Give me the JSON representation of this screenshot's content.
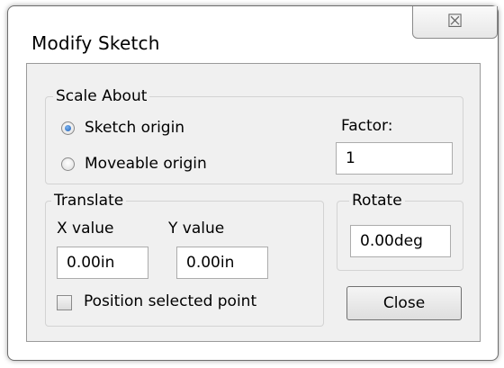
{
  "dialog": {
    "title": "Modify Sketch",
    "close_icon_glyph": "☒"
  },
  "scale_about": {
    "legend": "Scale About",
    "options": [
      {
        "label": "Sketch origin",
        "checked": true
      },
      {
        "label": "Moveable origin",
        "checked": false
      }
    ],
    "factor_label": "Factor:",
    "factor_value": "1"
  },
  "translate": {
    "legend": "Translate",
    "x_label": "X value",
    "y_label": "Y value",
    "x_value": "0.00in",
    "y_value": "0.00in",
    "position_selected_point_label": "Position selected point",
    "position_selected_point_checked": false
  },
  "rotate": {
    "legend": "Rotate",
    "value": "0.00deg"
  },
  "buttons": {
    "close_label": "Close"
  },
  "colors": {
    "dialog_background": "#f0f0f0",
    "radio_checked": "#1f5fb8"
  }
}
